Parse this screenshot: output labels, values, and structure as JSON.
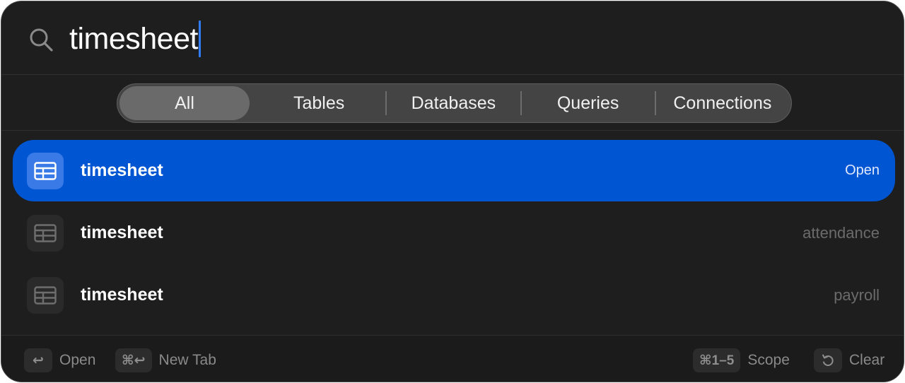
{
  "search": {
    "query": "timesheet"
  },
  "filters": {
    "tabs": [
      "All",
      "Tables",
      "Databases",
      "Queries",
      "Connections"
    ],
    "active": "All"
  },
  "results": [
    {
      "icon": "table-icon",
      "title": "timesheet",
      "meta": "Open",
      "selected": true
    },
    {
      "icon": "table-icon",
      "title": "timesheet",
      "meta": "attendance",
      "selected": false
    },
    {
      "icon": "table-icon",
      "title": "timesheet",
      "meta": "payroll",
      "selected": false
    }
  ],
  "footer": {
    "open": {
      "key": "↩",
      "label": "Open"
    },
    "new_tab": {
      "key": "⌘↩",
      "label": "New Tab"
    },
    "scope": {
      "key": "⌘1–5",
      "label": "Scope"
    },
    "clear": {
      "key_icon": "undo-icon",
      "label": "Clear"
    }
  },
  "colors": {
    "background": "#1e1e1e",
    "selection": "#0055d2",
    "caret": "#2f7cf6"
  }
}
